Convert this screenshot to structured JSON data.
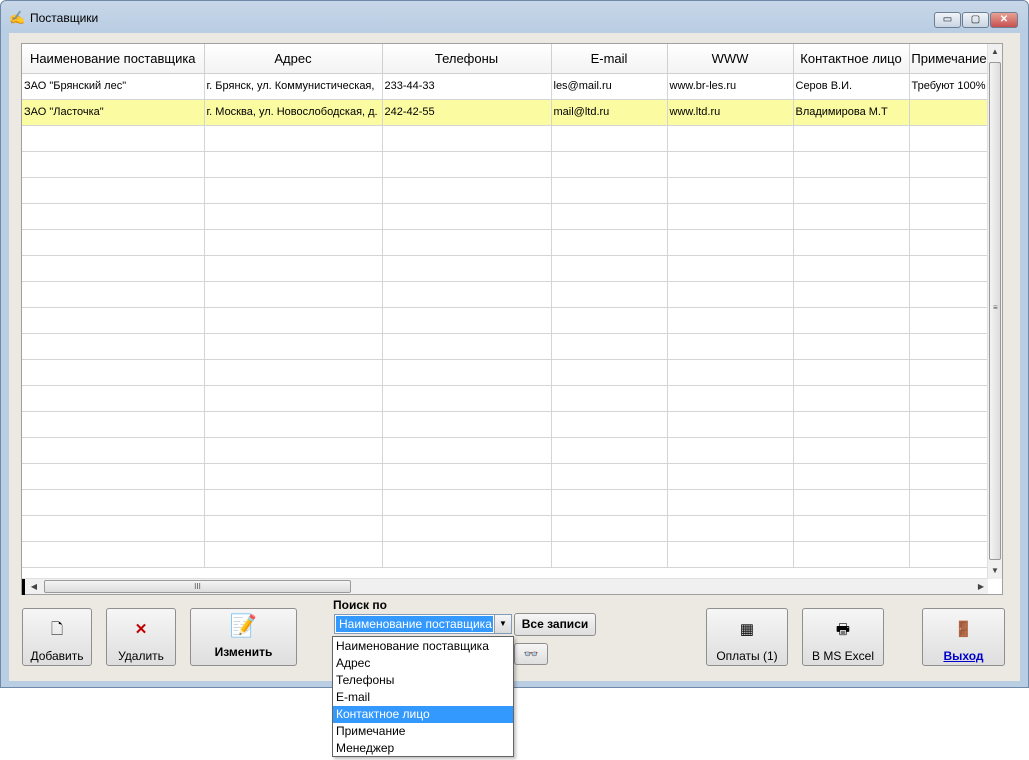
{
  "window": {
    "title": "Поставщики",
    "minimize": "▭",
    "maximize": "▢",
    "close": "✕"
  },
  "grid": {
    "columns": [
      "Наименование поставщика",
      "Адрес",
      "Телефоны",
      "E-mail",
      "WWW",
      "Контактное лицо",
      "Примечание"
    ],
    "rows": [
      [
        "ЗАО \"Брянский лес\"",
        "г. Брянск, ул. Коммунистическая,",
        "233-44-33",
        "les@mail.ru",
        "www.br-les.ru",
        "Серов В.И.",
        "Требуют 100%"
      ],
      [
        "ЗАО \"Ласточка\"",
        "г. Москва, ул. Новослободская, д.",
        "242-42-55",
        "mail@ltd.ru",
        "www.ltd.ru",
        "Владимирова М.Т",
        ""
      ]
    ],
    "selected_row": 1,
    "scroll_grip_v": "≡",
    "scroll_grip_h": "III"
  },
  "toolbar": {
    "add_label": "Добавить",
    "delete_label": "Удалить",
    "edit_label": "Изменить",
    "payments_label": "Оплаты (1)",
    "excel_label": "В MS Excel",
    "exit_label": "Выход"
  },
  "search": {
    "caption": "Поиск по",
    "selected": "Наименование поставщика",
    "all_records_label": "Все записи",
    "options": [
      "Наименование поставщика",
      "Адрес",
      "Телефоны",
      "E-mail",
      "Контактное лицо",
      "Примечание",
      "Менеджер"
    ],
    "highlighted_option": 4
  },
  "colors": {
    "selected_row": "#fbfba2",
    "highlight": "#3399ff",
    "link": "#0000cc"
  }
}
